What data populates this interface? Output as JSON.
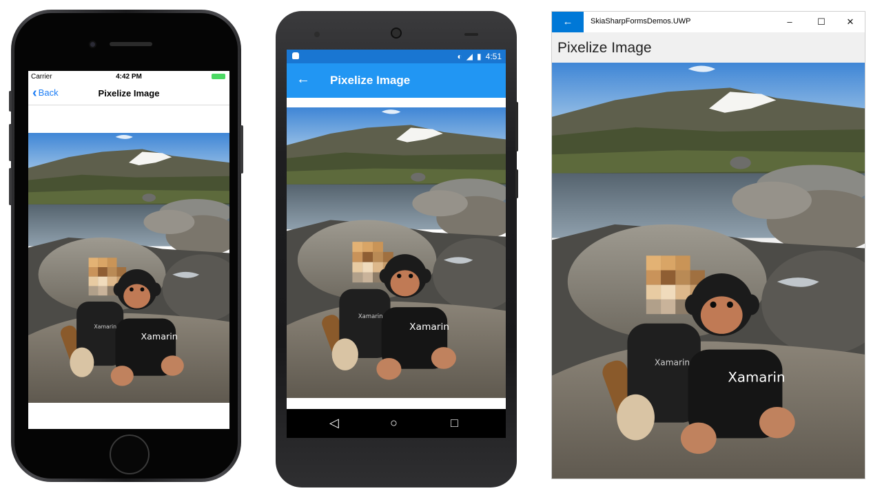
{
  "ios": {
    "carrier": "Carrier",
    "time": "4:42 PM",
    "back_label": "Back",
    "title": "Pixelize Image"
  },
  "android": {
    "time": "4:51",
    "title": "Pixelize Image"
  },
  "uwp": {
    "app_title": "SkiaSharpFormsDemos.UWP",
    "page_title": "Pixelize Image",
    "minimize": "–",
    "maximize": "☐",
    "close": "✕"
  },
  "photo": {
    "shirt_text": "Xamarin",
    "shirt_text_left": "Xamarin"
  },
  "colors": {
    "ios_tint": "#1a7cf5",
    "android_primary": "#2196f3",
    "android_primary_dark": "#1976d2",
    "uwp_accent": "#0078d7"
  }
}
